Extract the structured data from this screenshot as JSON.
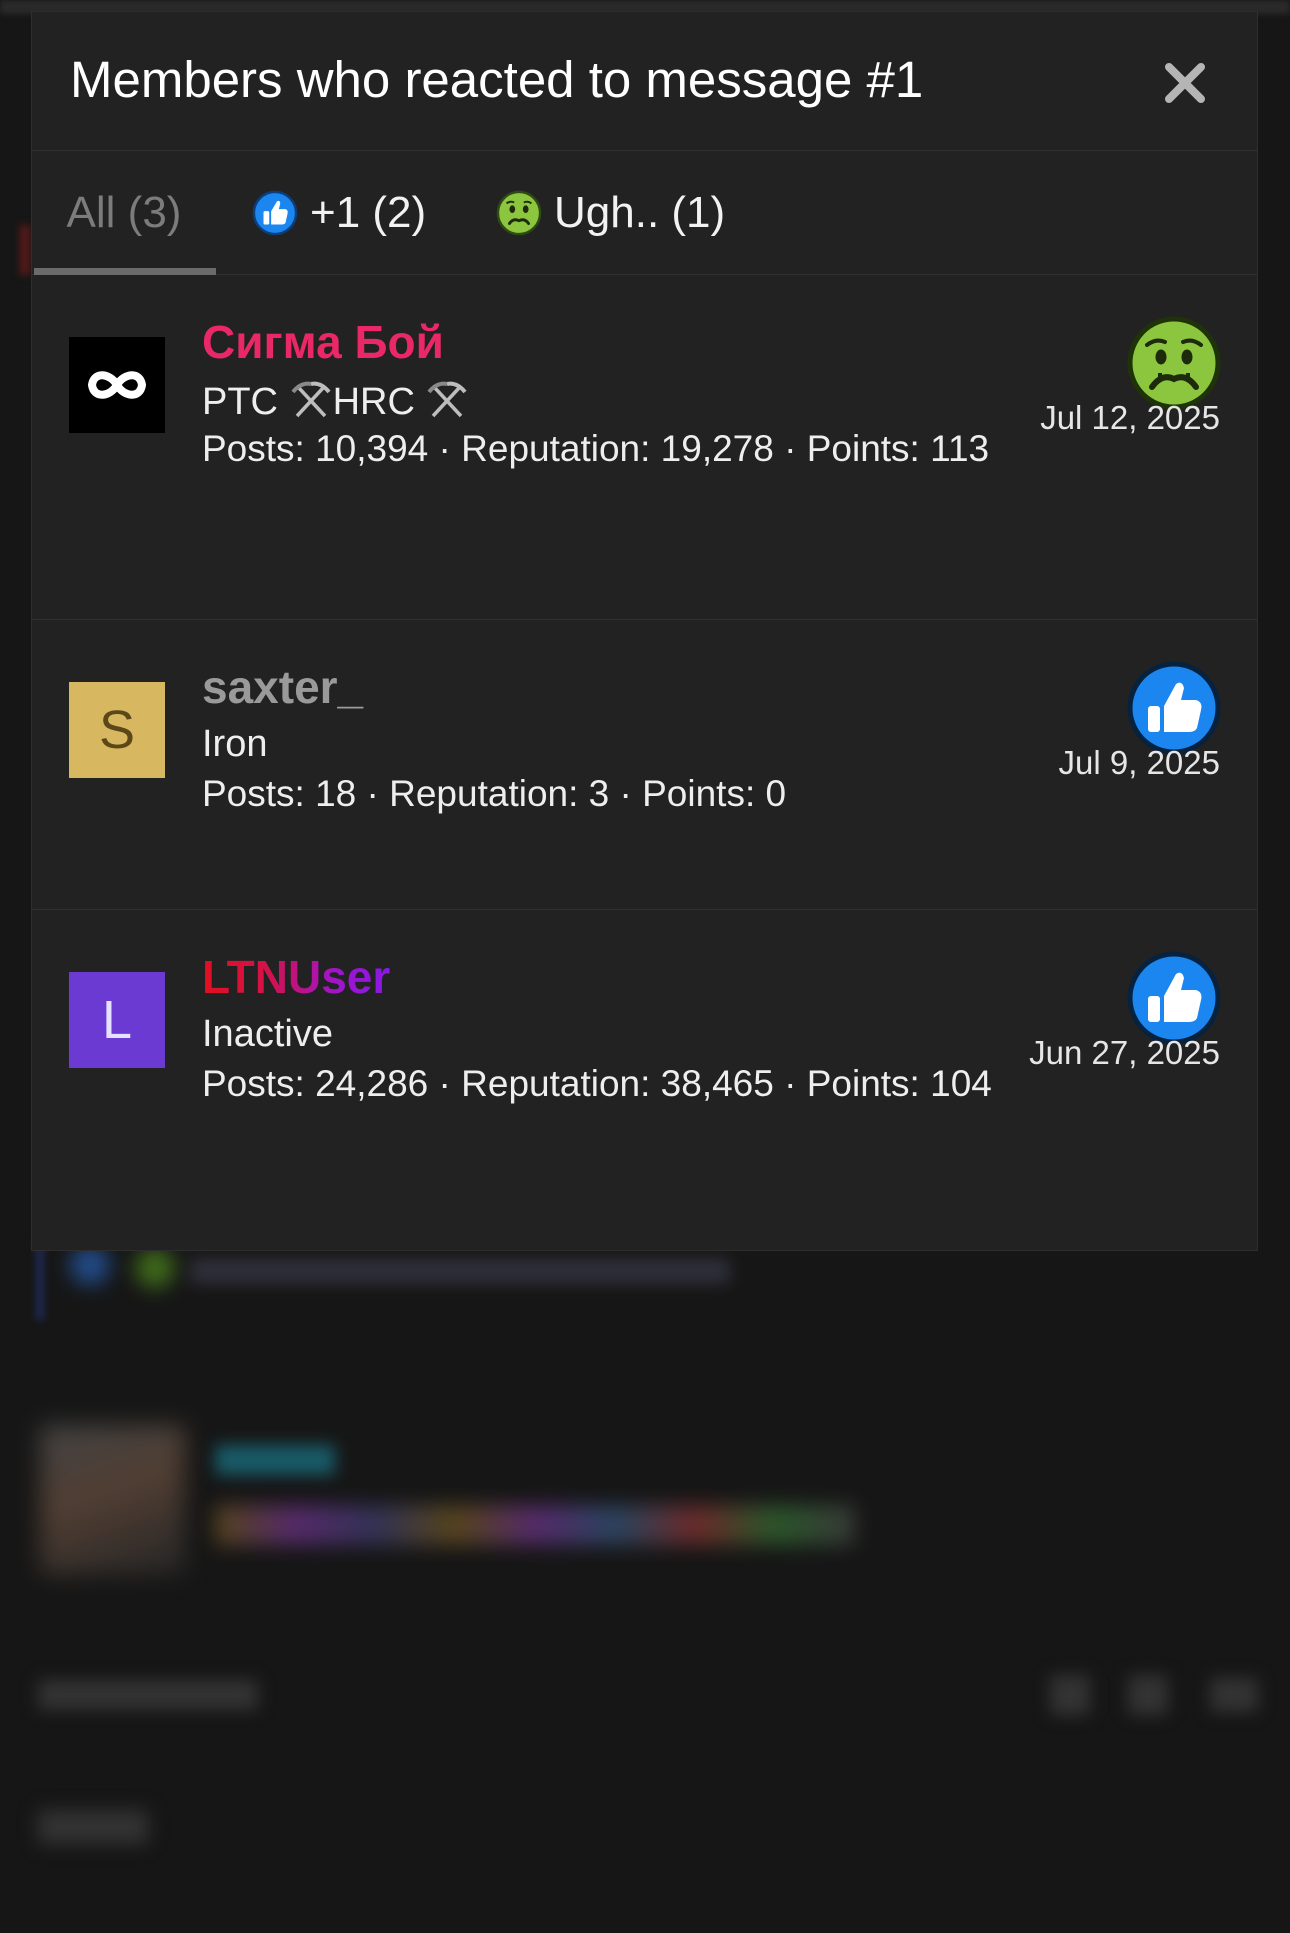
{
  "modal": {
    "title": "Members who reacted to message #1",
    "close_icon": "close-icon"
  },
  "tabs": [
    {
      "label": "All (3)",
      "active": true
    },
    {
      "label": "+1 (2)",
      "icon": "thumbs-up-icon"
    },
    {
      "label": "Ugh.. (1)",
      "icon": "nauseated-face-icon"
    }
  ],
  "members": [
    {
      "name": "Сигма Бой",
      "name_color": "#ea2868",
      "avatar_icon": "infinity-logo-icon",
      "title_part1": "PTC",
      "title_part2": "HRC",
      "stats_line": "Posts: 10,394 · Reputation: 19,278 · Points: 113",
      "reaction": "nauseated-face-icon",
      "date": "Jul 12, 2025"
    },
    {
      "name": "saxter_",
      "name_color": "#9a9a9a",
      "avatar_letter": "S",
      "title": "Iron",
      "stats_line": "Posts: 18 · Reputation: 3 · Points: 0",
      "reaction": "thumbs-up-icon",
      "date": "Jul 9, 2025"
    },
    {
      "name": "LTNUser",
      "avatar_letter": "L",
      "title": "Inactive",
      "stats_line": "Posts: 24,286 · Reputation: 38,465 · Points: 104",
      "reaction": "thumbs-up-icon",
      "date": "Jun 27, 2025"
    }
  ],
  "colors": {
    "modal_bg": "#222223",
    "page_bg": "#151515",
    "like_blue": "#1b86f0",
    "ugh_green": "#8cc63f"
  }
}
